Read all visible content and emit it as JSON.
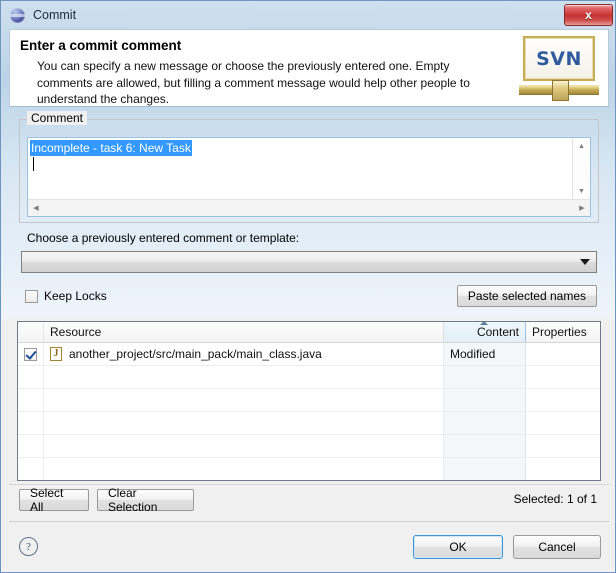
{
  "window": {
    "title": "Commit",
    "icon": "eclipse-globe-icon",
    "close_label": "x"
  },
  "header": {
    "title": "Enter a commit comment",
    "description": "You can specify a new message or choose the previously entered one. Empty comments are allowed, but filling a comment message would help other people to understand the changes.",
    "logo_text": "SVN"
  },
  "comment": {
    "group_label": "Comment",
    "value": "Incomplete - task 6: New Task",
    "selected": true
  },
  "template": {
    "label": "Choose a previously entered comment or template:",
    "selected_value": "",
    "options": []
  },
  "options_row": {
    "keep_locks_label": "Keep Locks",
    "keep_locks_checked": false,
    "paste_label": "Paste selected names"
  },
  "table": {
    "columns": [
      "",
      "Resource",
      "Content",
      "Properties"
    ],
    "sorted_column": "Content",
    "rows": [
      {
        "checked": true,
        "icon": "java-file-icon",
        "resource": "another_project/src/main_pack/main_class.java",
        "content": "Modified",
        "properties": ""
      }
    ],
    "empty_row_count": 5
  },
  "selection_bar": {
    "select_all_label": "Select All",
    "clear_selection_label": "Clear Selection",
    "selected_text": "Selected: 1 of 1"
  },
  "footer": {
    "help_label": "?",
    "ok_label": "OK",
    "cancel_label": "Cancel"
  },
  "colors": {
    "selection_blue": "#3399ff",
    "svn_blue": "#2f5b9e",
    "close_red": "#c63232",
    "default_button_border": "#3c94d4"
  }
}
